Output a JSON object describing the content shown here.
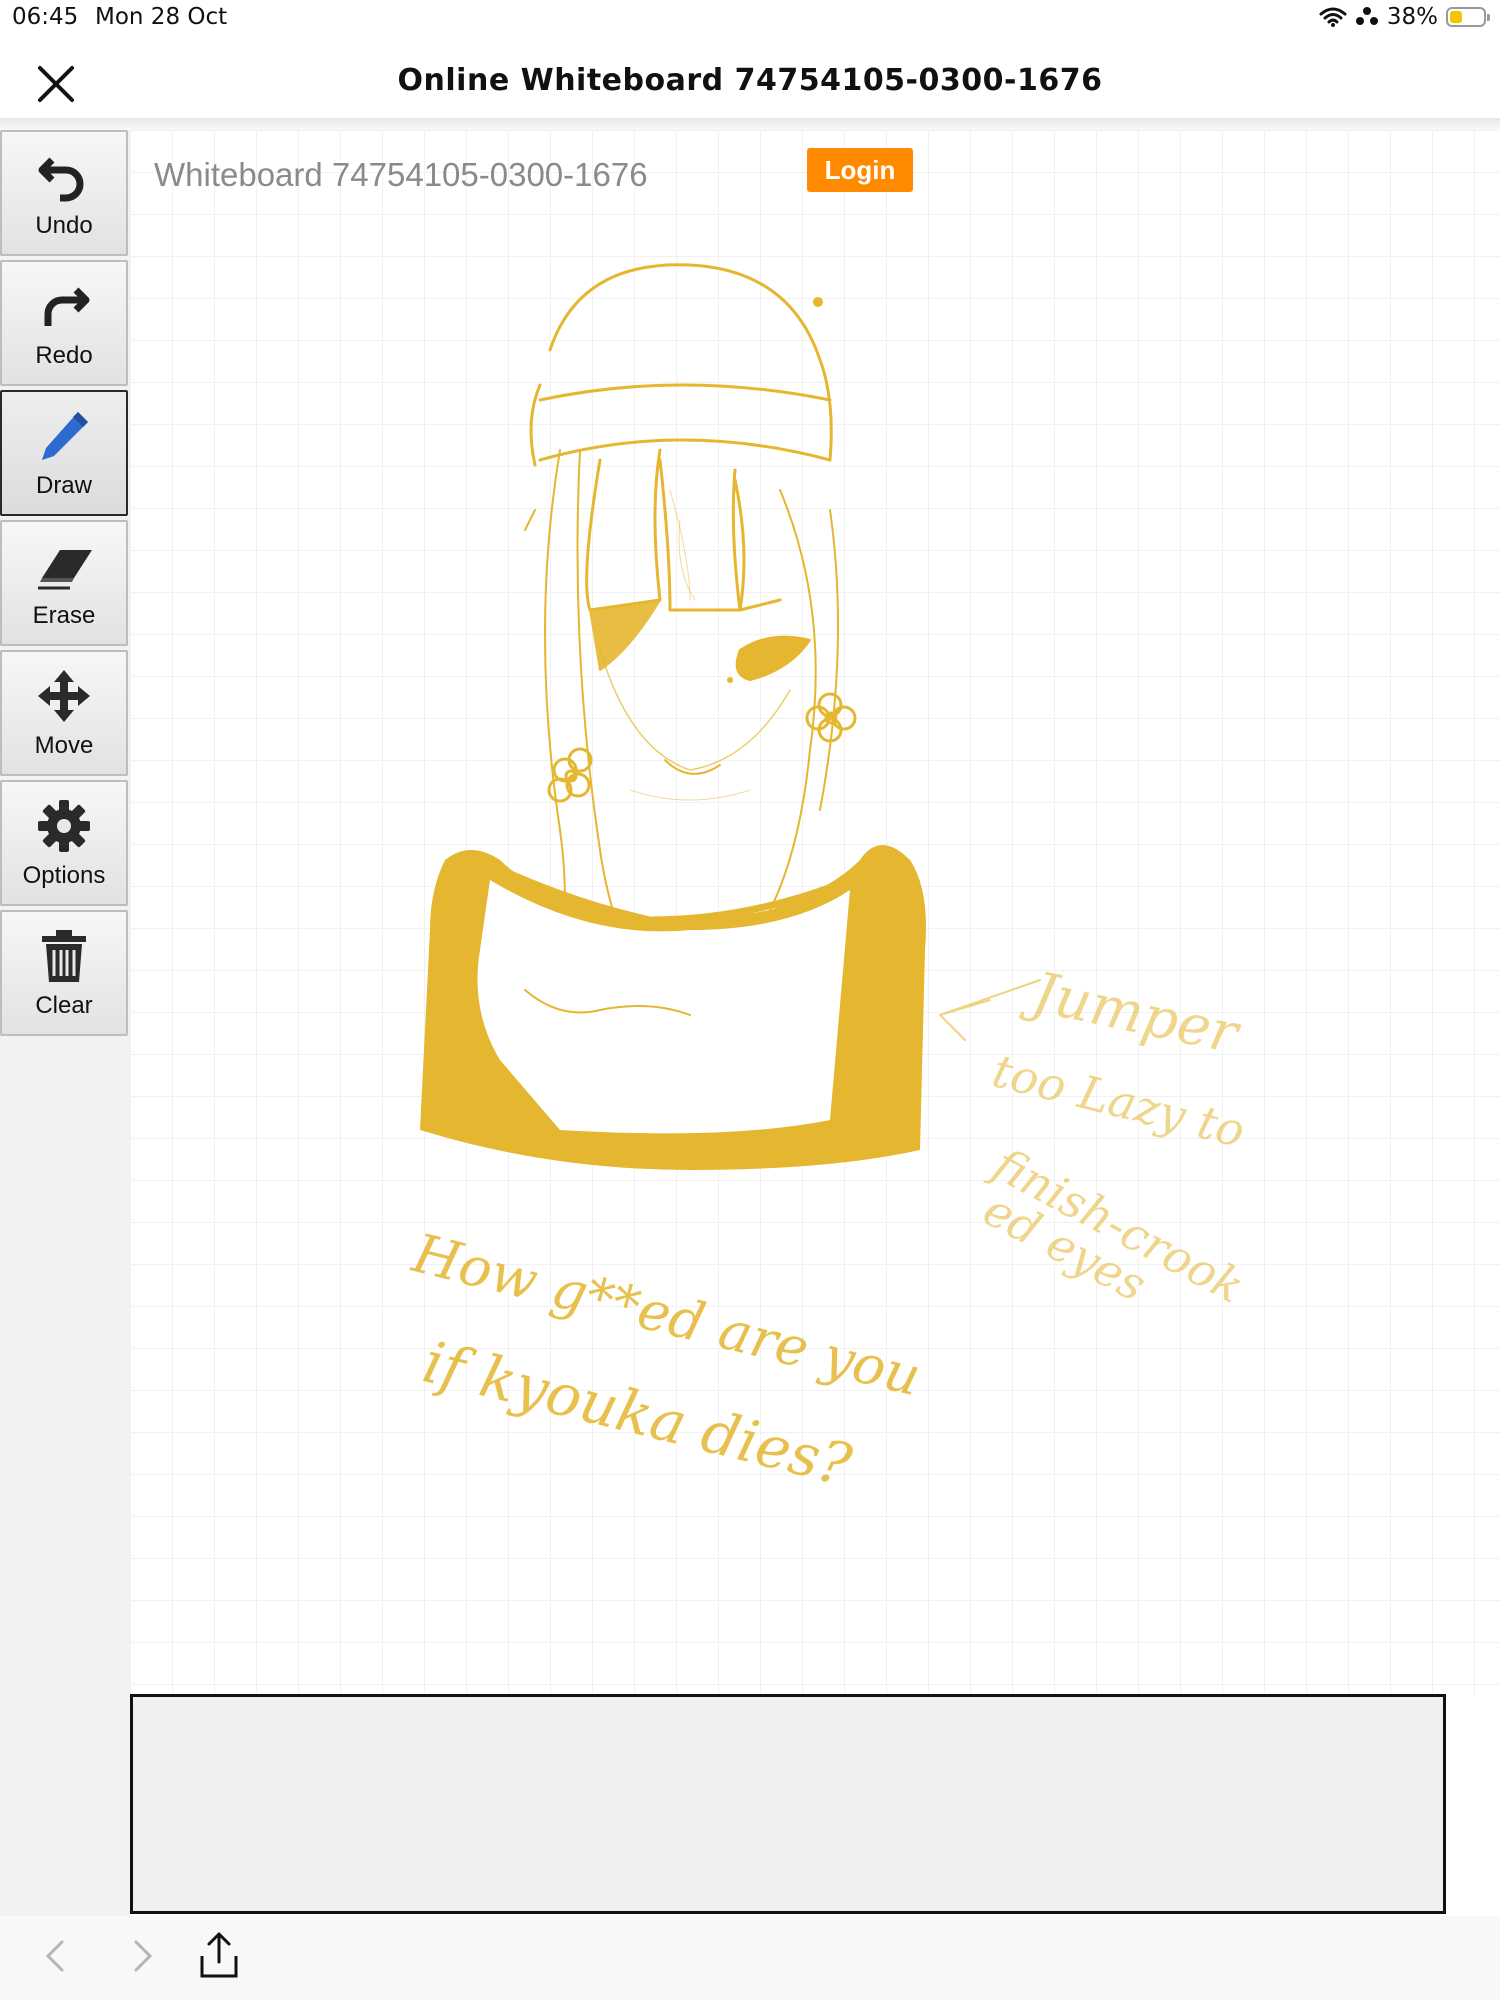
{
  "status": {
    "time": "06:45",
    "date": "Mon 28 Oct",
    "battery_text": "38%",
    "battery_level": 0.38,
    "battery_color": "#f5c400"
  },
  "nav": {
    "title": "Online Whiteboard 74754105-0300-1676",
    "close_icon": "close-icon"
  },
  "toolbar": {
    "items": [
      {
        "label": "Undo",
        "icon": "undo-icon"
      },
      {
        "label": "Redo",
        "icon": "redo-icon"
      },
      {
        "label": "Draw",
        "icon": "pencil-icon",
        "active": true
      },
      {
        "label": "Erase",
        "icon": "eraser-icon"
      },
      {
        "label": "Move",
        "icon": "move-arrows-icon"
      },
      {
        "label": "Options",
        "icon": "gear-icon"
      },
      {
        "label": "Clear",
        "icon": "trash-icon"
      }
    ]
  },
  "board": {
    "title": "Whiteboard 74754105-0300-1676",
    "login_label": "Login",
    "login_color": "#ff8a00",
    "ink_color": "#e5b62f",
    "drawing_description_text": {
      "annotation_lines": [
        "Jumper",
        "too Lazy to",
        "finish-crook",
        "ed eyes"
      ],
      "question_lines": [
        "How g**ed are you",
        "if kyouka dies?"
      ]
    }
  },
  "bottom_bar": {
    "back_icon": "chevron-left-icon",
    "forward_icon": "chevron-right-icon",
    "share_icon": "share-icon"
  }
}
